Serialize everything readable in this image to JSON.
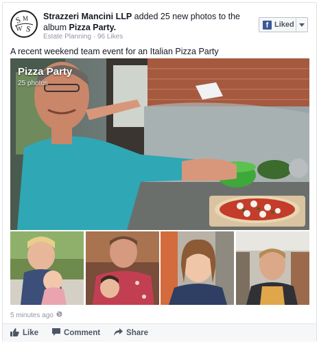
{
  "post": {
    "author": "Strazzeri Mancini LLP",
    "verb": " added 25 new photos to the album ",
    "album": "Pizza Party.",
    "category": "Estate Planning",
    "separator": " · ",
    "likes": "96 Likes",
    "message": "A recent weekend team event for an Italian Pizza Party",
    "timestamp": "5 minutes ago"
  },
  "liked_button": {
    "icon": "f",
    "label": "Liked"
  },
  "avatar": {
    "monogram": "SMWS"
  },
  "album_overlay": {
    "title": "Pizza Party",
    "count": "25 photos"
  },
  "actions": {
    "like": "Like",
    "comment": "Comment",
    "share": "Share"
  },
  "colors": {
    "facebook_blue": "#3b5998",
    "secondary_text": "#9197a3",
    "action_text": "#4e5665"
  }
}
